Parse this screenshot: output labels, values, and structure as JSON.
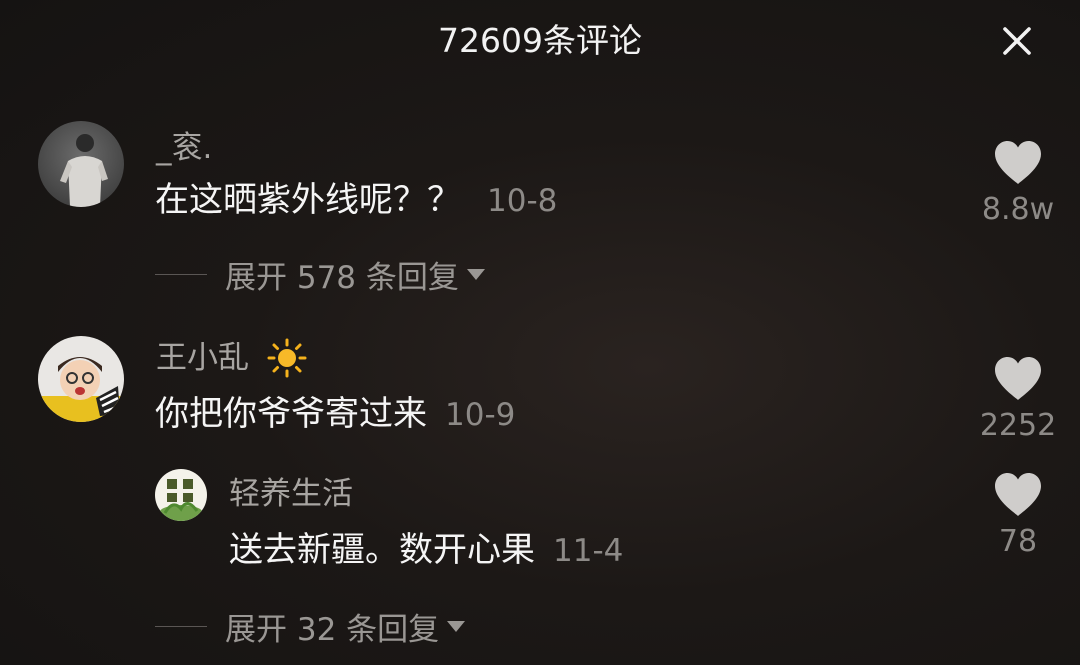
{
  "header": {
    "title": "72609条评论"
  },
  "comments": [
    {
      "username": "_衮.",
      "text": "在这晒紫外线呢？？",
      "date": "10-8",
      "likes": "8.8w",
      "expand_label": "展开 578 条回复"
    },
    {
      "username": "王小乱",
      "text": "你把你爷爷寄过来",
      "date": "10-9",
      "likes": "2252",
      "reply": {
        "username": "轻养生活",
        "text": "送去新疆。数开心果",
        "date": "11-4",
        "likes": "78"
      },
      "expand_label": "展开 32 条回复"
    }
  ],
  "icons": {
    "close": "close-icon",
    "like": "heart-icon",
    "expand": "triangle-down-icon",
    "badge": "sun-icon"
  }
}
